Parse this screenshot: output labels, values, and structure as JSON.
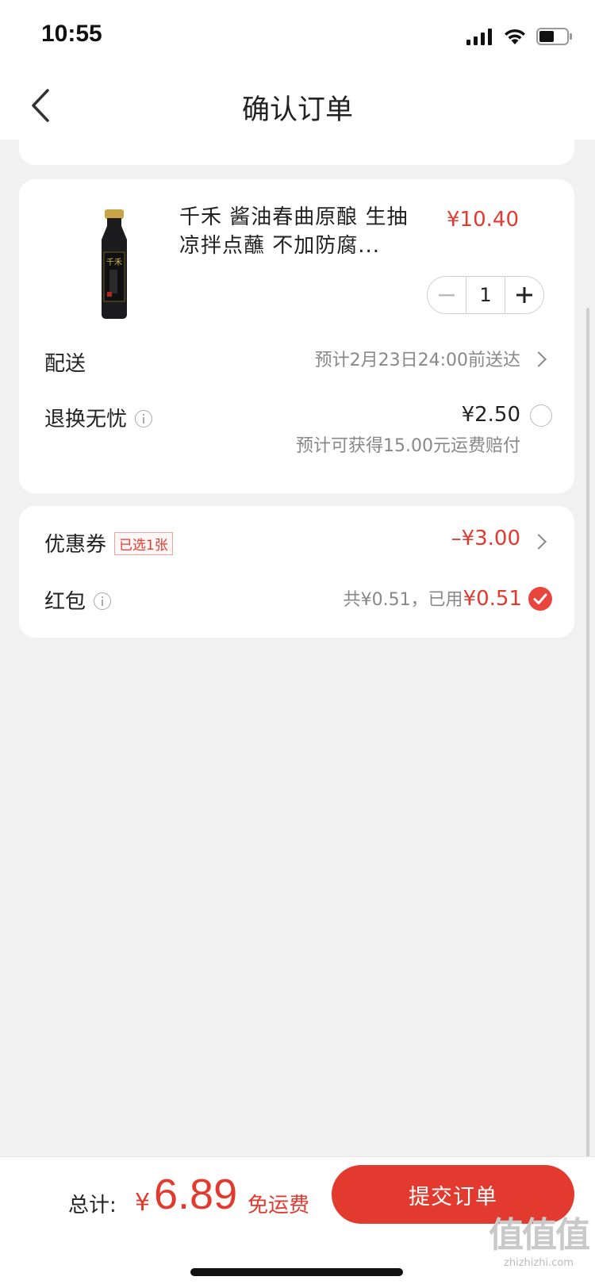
{
  "status_bar": {
    "time": "10:55"
  },
  "header": {
    "title": "确认订单"
  },
  "product": {
    "title": "千禾 酱油春曲原酿  生抽 凉拌点蘸 不加防腐...",
    "price": "¥10.40",
    "quantity": "1"
  },
  "delivery": {
    "label": "配送",
    "value": "预计2月23日24:00前送达"
  },
  "return_insurance": {
    "label": "退换无忧",
    "fee": "¥2.50",
    "note": "预计可获得15.00元运费赔付",
    "selected": false
  },
  "coupon": {
    "label": "优惠券",
    "badge": "已选1张",
    "value": "–¥3.00"
  },
  "red_packet": {
    "label": "红包",
    "total_text": "共¥0.51，已用",
    "used": "¥0.51",
    "selected": true
  },
  "footer": {
    "total_label": "总计:",
    "currency": "¥",
    "amount": "6.89",
    "shipping": "免运费",
    "submit_label": "提交订单"
  },
  "watermark": {
    "logo": "值值值",
    "url": "zhizhizhi.com"
  },
  "colors": {
    "accent": "#e23a2e",
    "background": "#f1f1f1",
    "card": "#ffffff",
    "muted": "#888888"
  }
}
